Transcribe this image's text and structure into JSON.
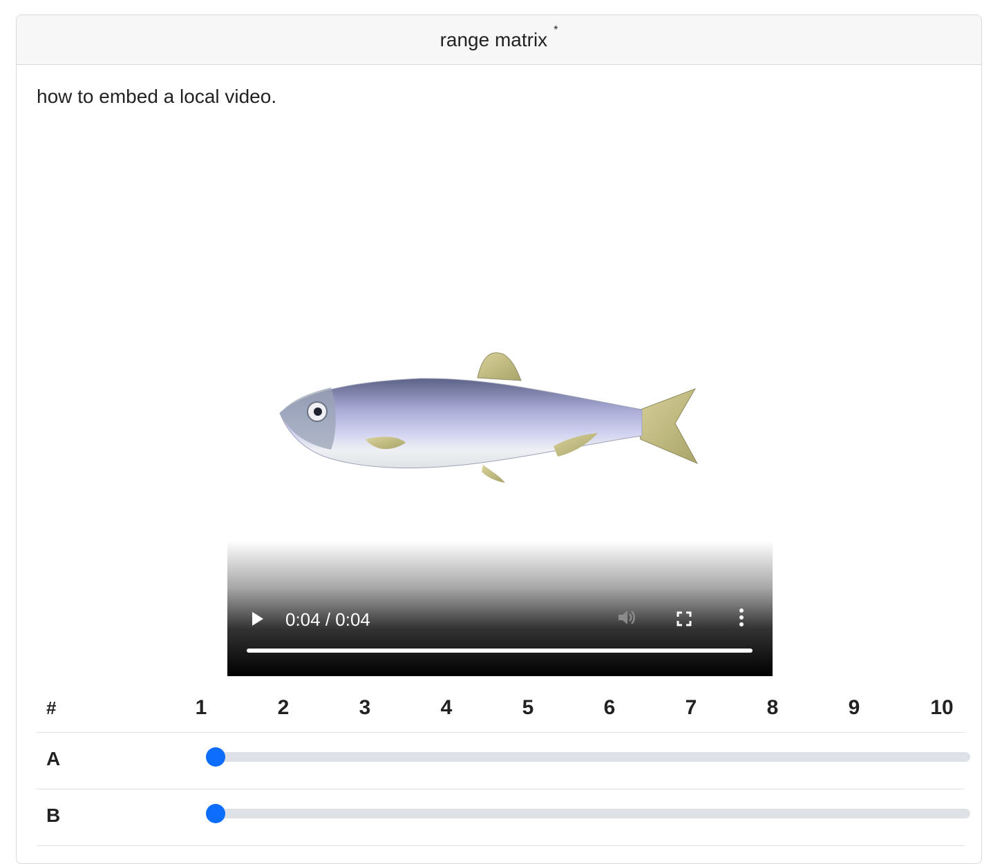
{
  "card": {
    "title": "range matrix",
    "required_marker": "*"
  },
  "question": {
    "text": "how to embed a local video."
  },
  "video": {
    "time_display": "0:04 / 0:04",
    "progress": 1.0,
    "icons": {
      "play": "play-icon",
      "mute": "volume-icon",
      "fullscreen": "fullscreen-icon",
      "menu": "more-vertical-icon"
    }
  },
  "matrix": {
    "corner_label": "#",
    "columns": [
      "1",
      "2",
      "3",
      "4",
      "5",
      "6",
      "7",
      "8",
      "9",
      "10"
    ],
    "rows": [
      {
        "label": "A",
        "value": 1,
        "min": 1,
        "max": 10
      },
      {
        "label": "B",
        "value": 1,
        "min": 1,
        "max": 10
      }
    ]
  },
  "colors": {
    "accent": "#0d6efd",
    "track": "#dee2e6"
  }
}
